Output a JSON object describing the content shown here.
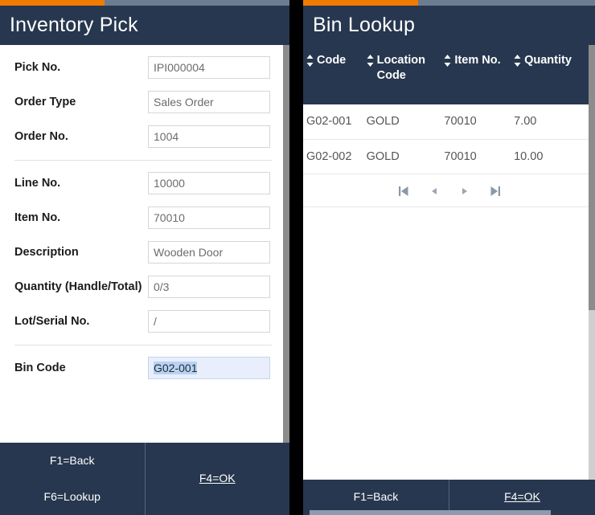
{
  "left_panel": {
    "title": "Inventory Pick",
    "progress_color": "#ef7c00",
    "header_color": "#27374f",
    "fields": [
      {
        "label": "Pick No.",
        "value": "IPI000004",
        "focused": false
      },
      {
        "label": "Order Type",
        "value": "Sales Order",
        "focused": false
      },
      {
        "label": "Order No.",
        "value": "1004",
        "focused": false
      },
      {
        "label": "Line No.",
        "value": "10000",
        "focused": false
      },
      {
        "label": "Item No.",
        "value": "70010",
        "focused": false
      },
      {
        "label": "Description",
        "value": "Wooden Door",
        "focused": false
      },
      {
        "label": "Quantity (Handle/Total)",
        "value": "0/3",
        "focused": false
      },
      {
        "label": "Lot/Serial No.",
        "value": "/",
        "focused": false
      },
      {
        "label": "Bin Code",
        "value": "G02-001",
        "focused": true
      }
    ],
    "commands": {
      "back": "F1=Back",
      "lookup": "F6=Lookup",
      "ok": "F4=OK"
    }
  },
  "right_panel": {
    "title": "Bin Lookup",
    "progress_color": "#ef7c00",
    "header_color": "#27374f",
    "table": {
      "columns": [
        {
          "label": "Code",
          "sort_icon": "sort-updown-icon"
        },
        {
          "label": "Location Code",
          "sort_icon": "sort-updown-icon"
        },
        {
          "label": "Item No.",
          "sort_icon": "sort-updown-icon"
        },
        {
          "label": "Quantity",
          "sort_icon": "sort-updown-icon"
        }
      ],
      "rows": [
        {
          "code": "G02-001",
          "location_code": "GOLD",
          "item_no": "70010",
          "quantity": "7.00"
        },
        {
          "code": "G02-002",
          "location_code": "GOLD",
          "item_no": "70010",
          "quantity": "10.00"
        }
      ]
    },
    "pagination": {
      "first": "first-page-icon",
      "prev": "previous-page-icon",
      "next": "next-page-icon",
      "last": "last-page-icon"
    },
    "commands": {
      "back": "F1=Back",
      "ok": "F4=OK"
    }
  }
}
